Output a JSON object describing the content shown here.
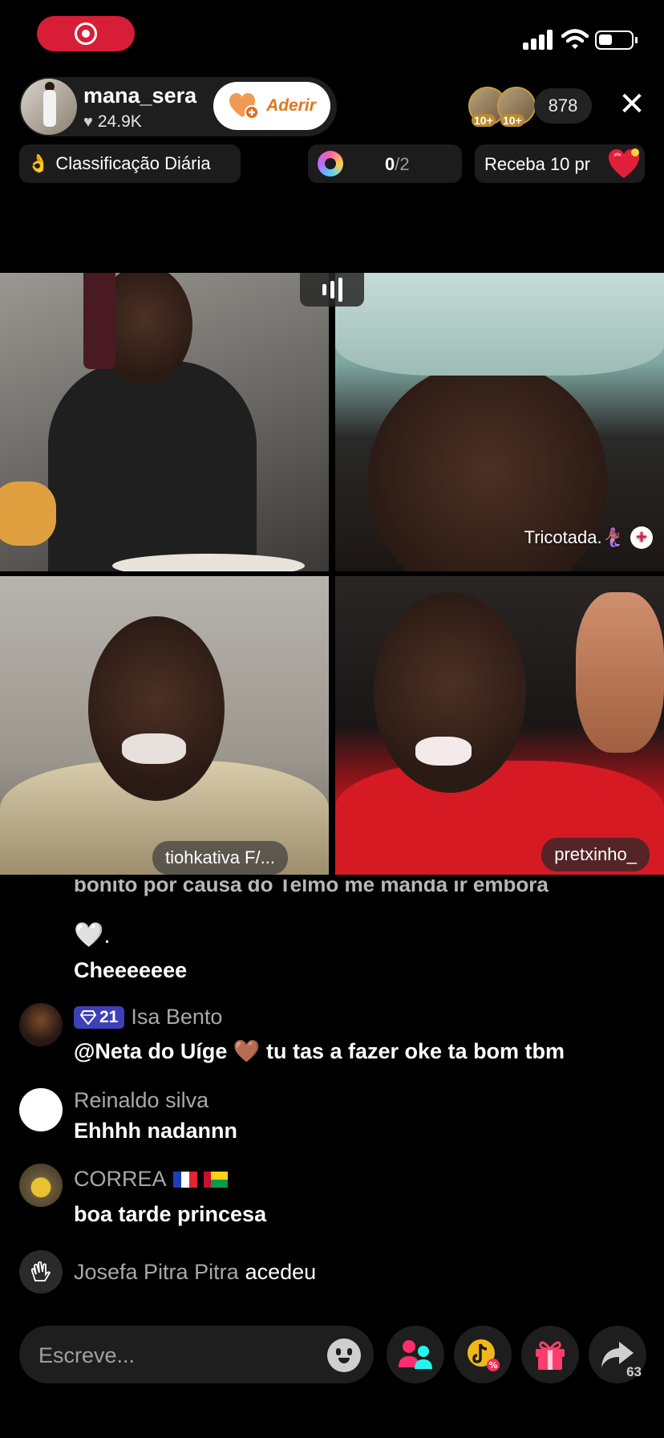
{
  "status_bar": {
    "icons": [
      "record-icon",
      "signal-icon",
      "wifi-icon",
      "battery-icon"
    ]
  },
  "host": {
    "name": "mana_sera",
    "likes": "24.9K",
    "follow_label": "Aderir"
  },
  "viewers": {
    "badges": [
      "10+",
      "10+"
    ],
    "count": "878"
  },
  "pills": {
    "ranking": "Classificação Diária",
    "ranking_emoji": "👌",
    "goal_current": "0",
    "goal_total": "/2",
    "reward": "Receba 10 pr"
  },
  "guests": {
    "tile2_name": "Tricotada.🧜🏾‍♀️",
    "tile3_name": "tiohkativa F/...",
    "tile4_name": "pretxinho_"
  },
  "chat": {
    "cut_message": "bonito por causa do Telmo  me manda ir embora",
    "heart_line": "🤍.",
    "messages": [
      {
        "text": "Cheeeeeee"
      },
      {
        "level": "21",
        "user": "Isa Bento",
        "text": "@Neta do Uíge 🤎 tu tas a fazer oke ta bom tbm"
      },
      {
        "user": "Reinaldo silva",
        "text": "Ehhhh nadannn"
      },
      {
        "user": "CORREA",
        "text": "boa tarde princesa"
      }
    ],
    "join": {
      "user": "Josefa Pitra Pitra",
      "action": "acedeu"
    }
  },
  "bottom_bar": {
    "comment_placeholder": "Escreve...",
    "share_count": "63"
  },
  "colors": {
    "record_red": "#d81e36",
    "follow_orange": "#e0761e",
    "level_badge": "#3f40b8",
    "background": "#000000"
  }
}
